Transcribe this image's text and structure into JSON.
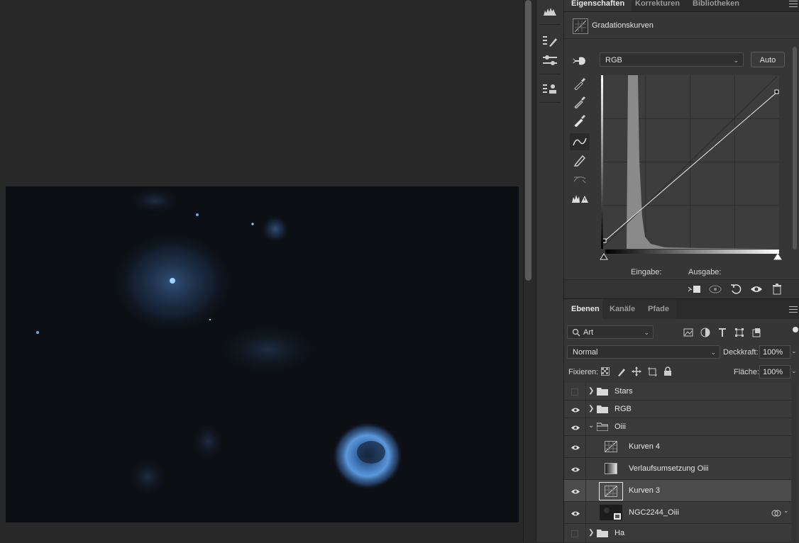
{
  "properties_panel": {
    "tabs": [
      "Eigenschaften",
      "Korrekturen",
      "Bibliotheken"
    ],
    "active_tab": "Eigenschaften",
    "adjustment_title": "Gradationskurven",
    "channel": "RGB",
    "auto_label": "Auto",
    "input_label": "Eingabe:",
    "output_label": "Ausgabe:"
  },
  "layers_panel": {
    "tabs": [
      "Ebenen",
      "Kanäle",
      "Pfade"
    ],
    "active_tab": "Ebenen",
    "filter_kind": "Art",
    "blend_mode": "Normal",
    "opacity_label": "Deckkraft:",
    "opacity_value": "100%",
    "lock_label": "Fixieren:",
    "fill_label": "Fläche:",
    "fill_value": "100%",
    "layers": [
      {
        "name": "Stars",
        "type": "group",
        "visible": false,
        "expanded": false
      },
      {
        "name": "RGB",
        "type": "group",
        "visible": true,
        "expanded": false
      },
      {
        "name": "Oiii",
        "type": "group",
        "visible": true,
        "expanded": true
      },
      {
        "name": "Kurven 4",
        "type": "curves",
        "visible": true
      },
      {
        "name": "Verlaufsumsetzung Oiii",
        "type": "gradient-map",
        "visible": true
      },
      {
        "name": "Kurven 3",
        "type": "curves",
        "visible": true,
        "selected": true
      },
      {
        "name": "NGC2244_Oiii",
        "type": "smart-object",
        "visible": true
      },
      {
        "name": "Ha",
        "type": "group",
        "visible": false,
        "expanded": false
      }
    ]
  },
  "colors": {
    "panel_bg": "#363636",
    "canvas_bg": "#282828",
    "nebula_blue": "#4a86c6"
  }
}
